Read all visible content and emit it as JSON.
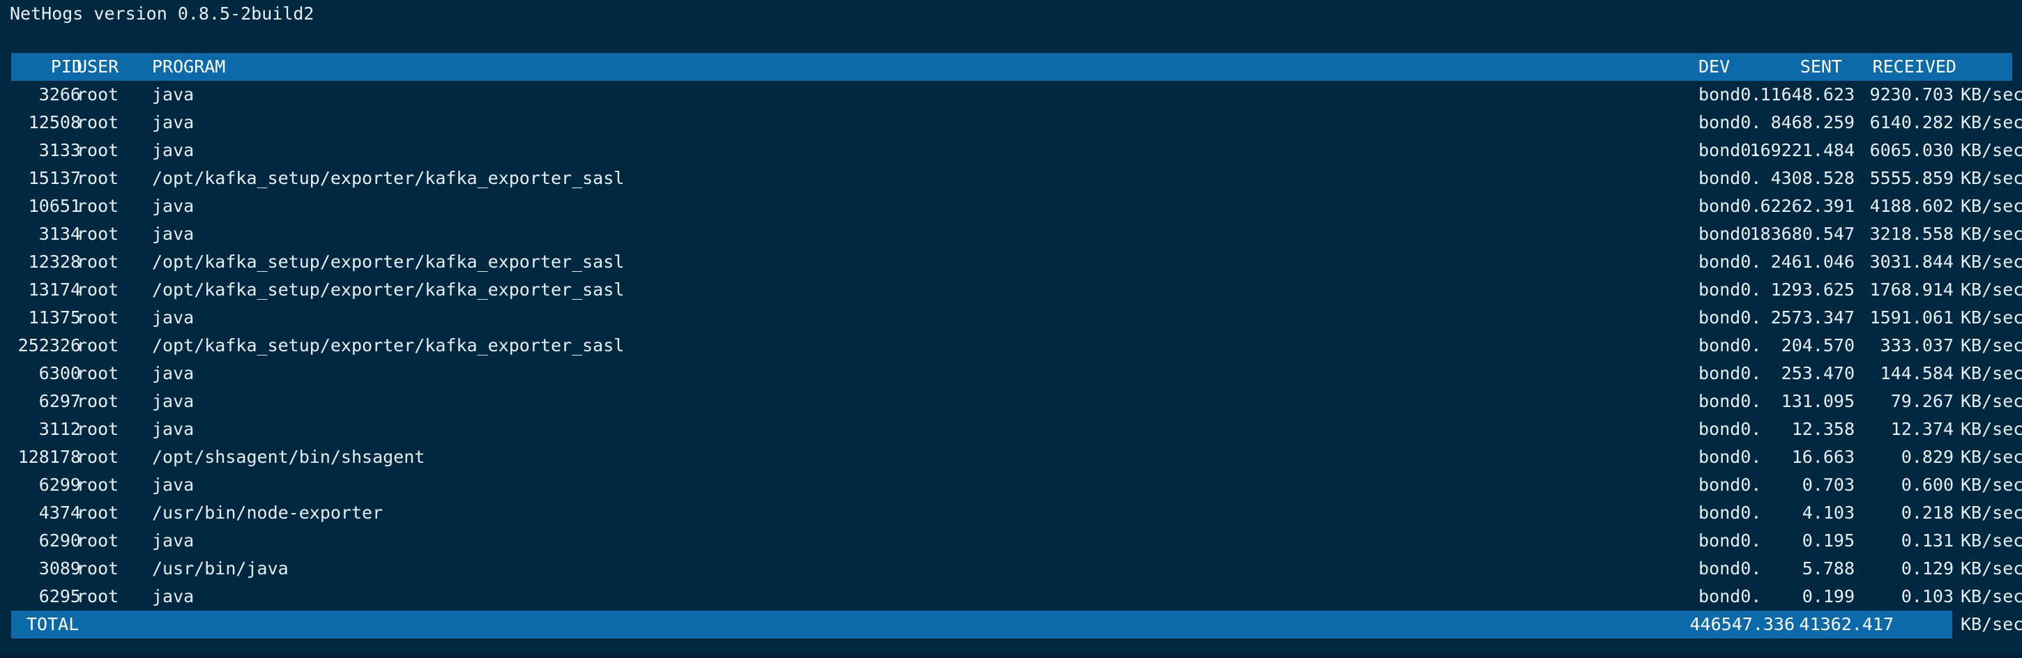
{
  "app": {
    "title": "NetHogs version 0.8.5-2build2"
  },
  "table": {
    "headers": {
      "pid": "PID",
      "user": "USER",
      "program": "PROGRAM",
      "dev": "DEV",
      "sent": "SENT",
      "received": "RECEIVED"
    },
    "rows": [
      {
        "pid": "3266",
        "user": "root",
        "program": "java",
        "dev": "bond0.",
        "sent": "11648.623",
        "received": "9230.703",
        "unit": "KB/sec"
      },
      {
        "pid": "12508",
        "user": "root",
        "program": "java",
        "dev": "bond0.",
        "sent": "8468.259",
        "received": "6140.282",
        "unit": "KB/sec"
      },
      {
        "pid": "3133",
        "user": "root",
        "program": "java",
        "dev": "bond0.",
        "sent": "169221.484",
        "received": "6065.030",
        "unit": "KB/sec"
      },
      {
        "pid": "15137",
        "user": "root",
        "program": "/opt/kafka_setup/exporter/kafka_exporter_sasl",
        "dev": "bond0.",
        "sent": "4308.528",
        "received": "5555.859",
        "unit": "KB/sec"
      },
      {
        "pid": "10651",
        "user": "root",
        "program": "java",
        "dev": "bond0.",
        "sent": "62262.391",
        "received": "4188.602",
        "unit": "KB/sec"
      },
      {
        "pid": "3134",
        "user": "root",
        "program": "java",
        "dev": "bond0.",
        "sent": "183680.547",
        "received": "3218.558",
        "unit": "KB/sec"
      },
      {
        "pid": "12328",
        "user": "root",
        "program": "/opt/kafka_setup/exporter/kafka_exporter_sasl",
        "dev": "bond0.",
        "sent": "2461.046",
        "received": "3031.844",
        "unit": "KB/sec"
      },
      {
        "pid": "13174",
        "user": "root",
        "program": "/opt/kafka_setup/exporter/kafka_exporter_sasl",
        "dev": "bond0.",
        "sent": "1293.625",
        "received": "1768.914",
        "unit": "KB/sec"
      },
      {
        "pid": "11375",
        "user": "root",
        "program": "java",
        "dev": "bond0.",
        "sent": "2573.347",
        "received": "1591.061",
        "unit": "KB/sec"
      },
      {
        "pid": "252326",
        "user": "root",
        "program": "/opt/kafka_setup/exporter/kafka_exporter_sasl",
        "dev": "bond0.",
        "sent": "204.570",
        "received": "333.037",
        "unit": "KB/sec"
      },
      {
        "pid": "6300",
        "user": "root",
        "program": "java",
        "dev": "bond0.",
        "sent": "253.470",
        "received": "144.584",
        "unit": "KB/sec"
      },
      {
        "pid": "6297",
        "user": "root",
        "program": "java",
        "dev": "bond0.",
        "sent": "131.095",
        "received": "79.267",
        "unit": "KB/sec"
      },
      {
        "pid": "3112",
        "user": "root",
        "program": "java",
        "dev": "bond0.",
        "sent": "12.358",
        "received": "12.374",
        "unit": "KB/sec"
      },
      {
        "pid": "128178",
        "user": "root",
        "program": "/opt/shsagent/bin/shsagent",
        "dev": "bond0.",
        "sent": "16.663",
        "received": "0.829",
        "unit": "KB/sec"
      },
      {
        "pid": "6299",
        "user": "root",
        "program": "java",
        "dev": "bond0.",
        "sent": "0.703",
        "received": "0.600",
        "unit": "KB/sec"
      },
      {
        "pid": "4374",
        "user": "root",
        "program": "/usr/bin/node-exporter",
        "dev": "bond0.",
        "sent": "4.103",
        "received": "0.218",
        "unit": "KB/sec"
      },
      {
        "pid": "6290",
        "user": "root",
        "program": "java",
        "dev": "bond0.",
        "sent": "0.195",
        "received": "0.131",
        "unit": "KB/sec"
      },
      {
        "pid": "3089",
        "user": "root",
        "program": "/usr/bin/java",
        "dev": "bond0.",
        "sent": "5.788",
        "received": "0.129",
        "unit": "KB/sec"
      },
      {
        "pid": "6295",
        "user": "root",
        "program": "java",
        "dev": "bond0.",
        "sent": "0.199",
        "received": "0.103",
        "unit": "KB/sec"
      }
    ],
    "total": {
      "label": "TOTAL",
      "sent": "446547.336",
      "received": "41362.417",
      "unit": "KB/sec"
    }
  },
  "colors": {
    "background": "#002841",
    "header_bar": "#0d6aa8",
    "text": "#e9eef2"
  }
}
